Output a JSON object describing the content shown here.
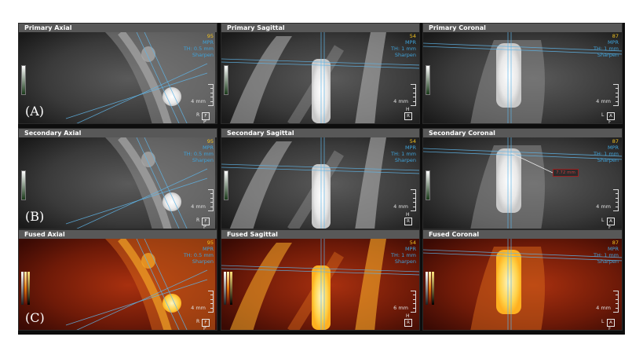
{
  "panels": [
    {
      "title": "Primary Axial",
      "slice": "95",
      "mode": "MPR",
      "thickness": "TH: 0.5 mm",
      "filter": "Sharpen",
      "scale": "4 mm",
      "orient": {
        "top": "",
        "left": "R",
        "box": "F",
        "bottom": "P"
      },
      "label": "(A)",
      "style": "gray"
    },
    {
      "title": "Primary Sagittal",
      "slice": "54",
      "mode": "MPR",
      "thickness": "TH: 1 mm",
      "filter": "Sharpen",
      "scale": "4 mm",
      "orient": {
        "top": "H",
        "left": "",
        "box": "R",
        "bottom": ""
      },
      "label": "",
      "style": "gray"
    },
    {
      "title": "Primary Coronal",
      "slice": "87",
      "mode": "MPR",
      "thickness": "TH: 1 mm",
      "filter": "Sharpen",
      "scale": "4 mm",
      "orient": {
        "top": "",
        "left": "L",
        "box": "A",
        "bottom": "F"
      },
      "label": "",
      "style": "gray"
    },
    {
      "title": "Secondary Axial",
      "slice": "95",
      "mode": "MPR",
      "thickness": "TH: 0.5 mm",
      "filter": "Sharpen",
      "scale": "4 mm",
      "orient": {
        "top": "",
        "left": "R",
        "box": "F",
        "bottom": "P"
      },
      "label": "(B)",
      "style": "gray"
    },
    {
      "title": "Secondary Sagittal",
      "slice": "54",
      "mode": "MPR",
      "thickness": "TH: 1 mm",
      "filter": "Sharpen",
      "scale": "4 mm",
      "orient": {
        "top": "H",
        "left": "",
        "box": "R",
        "bottom": ""
      },
      "label": "",
      "style": "gray"
    },
    {
      "title": "Secondary Coronal",
      "slice": "87",
      "mode": "MPR",
      "thickness": "TH: 1 mm",
      "filter": "Sharpen",
      "scale": "4 mm",
      "orient": {
        "top": "",
        "left": "L",
        "box": "A",
        "bottom": "F"
      },
      "label": "",
      "style": "gray",
      "measurement": "7.72 mm"
    },
    {
      "title": "Fused Axial",
      "slice": "95",
      "mode": "MPR",
      "thickness": "TH: 0.5 mm",
      "filter": "Sharpen",
      "scale": "4 mm",
      "orient": {
        "top": "",
        "left": "R",
        "box": "F",
        "bottom": "P"
      },
      "label": "(C)",
      "style": "fused"
    },
    {
      "title": "Fused Sagittal",
      "slice": "54",
      "mode": "MPR",
      "thickness": "TH: 1 mm",
      "filter": "Sharpen",
      "scale": "6 mm",
      "orient": {
        "top": "H",
        "left": "",
        "box": "R",
        "bottom": ""
      },
      "label": "",
      "style": "fused"
    },
    {
      "title": "Fused Coronal",
      "slice": "87",
      "mode": "MPR",
      "thickness": "TH: 1 mm",
      "filter": "Sharpen",
      "scale": "4 mm",
      "orient": {
        "top": "",
        "left": "L",
        "box": "A",
        "bottom": "F"
      },
      "label": "",
      "style": "fused"
    }
  ],
  "colors": {
    "header": "#585858",
    "slice_number": "#f0c020",
    "overlay_text": "#3fa2d9",
    "crosshair": "#5fb4e6",
    "measurement_border": "#9a1f1f",
    "fused_high": "#ffe27a",
    "fused_low": "#5a0c08"
  },
  "icons": [
    "window-level-bar-icon",
    "orientation-cube-icon",
    "scale-ruler-icon",
    "crosshair-icon"
  ]
}
